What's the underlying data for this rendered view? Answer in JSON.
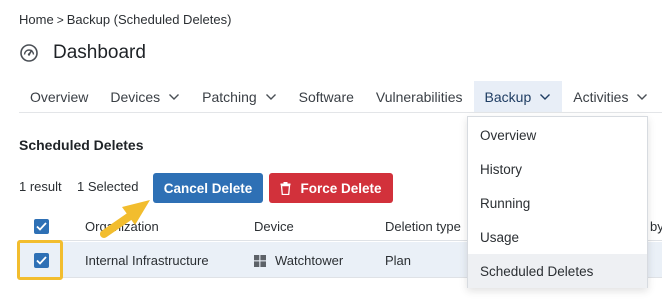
{
  "breadcrumb": {
    "home": "Home",
    "separator": ">",
    "current": "Backup (Scheduled Deletes)"
  },
  "page": {
    "title": "Dashboard"
  },
  "tabs": [
    {
      "label": "Overview"
    },
    {
      "label": "Devices"
    },
    {
      "label": "Patching"
    },
    {
      "label": "Software"
    },
    {
      "label": "Vulnerabilities"
    },
    {
      "label": "Backup"
    },
    {
      "label": "Activities"
    }
  ],
  "section": {
    "title": "Scheduled Deletes"
  },
  "toolbar": {
    "result_count": "1 result",
    "selected_count": "1 Selected",
    "cancel_label": "Cancel Delete",
    "force_label": "Force Delete"
  },
  "table": {
    "headers": {
      "organization": "Organization",
      "device": "Device",
      "deletion_type": "Deletion type",
      "partial_edge": "by"
    },
    "rows": [
      {
        "organization": "Internal Infrastructure",
        "device": "Watchtower",
        "deletion_type": "Plan"
      }
    ]
  },
  "backup_menu": {
    "items": [
      {
        "label": "Overview"
      },
      {
        "label": "History"
      },
      {
        "label": "Running"
      },
      {
        "label": "Usage"
      },
      {
        "label": "Scheduled Deletes"
      }
    ]
  },
  "colors": {
    "primary": "#2e70b5",
    "danger": "#d2313b",
    "highlight": "#f2bd2e",
    "active_tab": "#e8eef7"
  },
  "icons": {
    "dashboard": "gauge-icon",
    "trash": "trash-icon",
    "device": "windows-icon",
    "chevron": "chevron-down-icon",
    "check": "check-icon",
    "annotation": "arrow-icon"
  }
}
